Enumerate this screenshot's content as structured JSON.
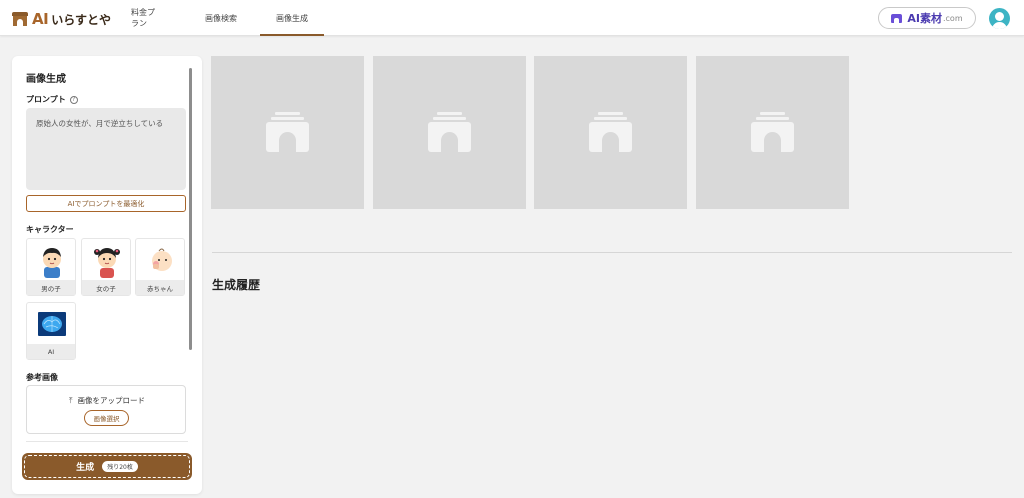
{
  "header": {
    "logo_ai": "AI",
    "logo_text": "いらすとや",
    "nav": [
      {
        "label": "料金プラン"
      },
      {
        "label": "画像検索"
      },
      {
        "label": "画像生成"
      }
    ],
    "ai_material": {
      "main": "AI素材",
      "suffix": ".com"
    }
  },
  "panel": {
    "title": "画像生成",
    "prompt_label": "プロンプト",
    "prompt_help": "?",
    "prompt_value": "原始人の女性が、月で逆立ちしている",
    "optimize_button": "AIでプロンプトを最適化",
    "characters_label": "キャラクター",
    "characters": [
      {
        "label": "男の子"
      },
      {
        "label": "女の子"
      },
      {
        "label": "赤ちゃん"
      },
      {
        "label": "AI"
      }
    ],
    "reference_label": "参考画像",
    "upload_text": "画像をアップロード",
    "select_button": "画像選択",
    "generate_button": "生成",
    "remaining_badge": "残り20枚"
  },
  "main": {
    "history_title": "生成履歴"
  },
  "colors": {
    "brand": "#8a5a2b",
    "ai_material_accent": "#4b3bb0",
    "avatar": "#3cb4c4"
  }
}
